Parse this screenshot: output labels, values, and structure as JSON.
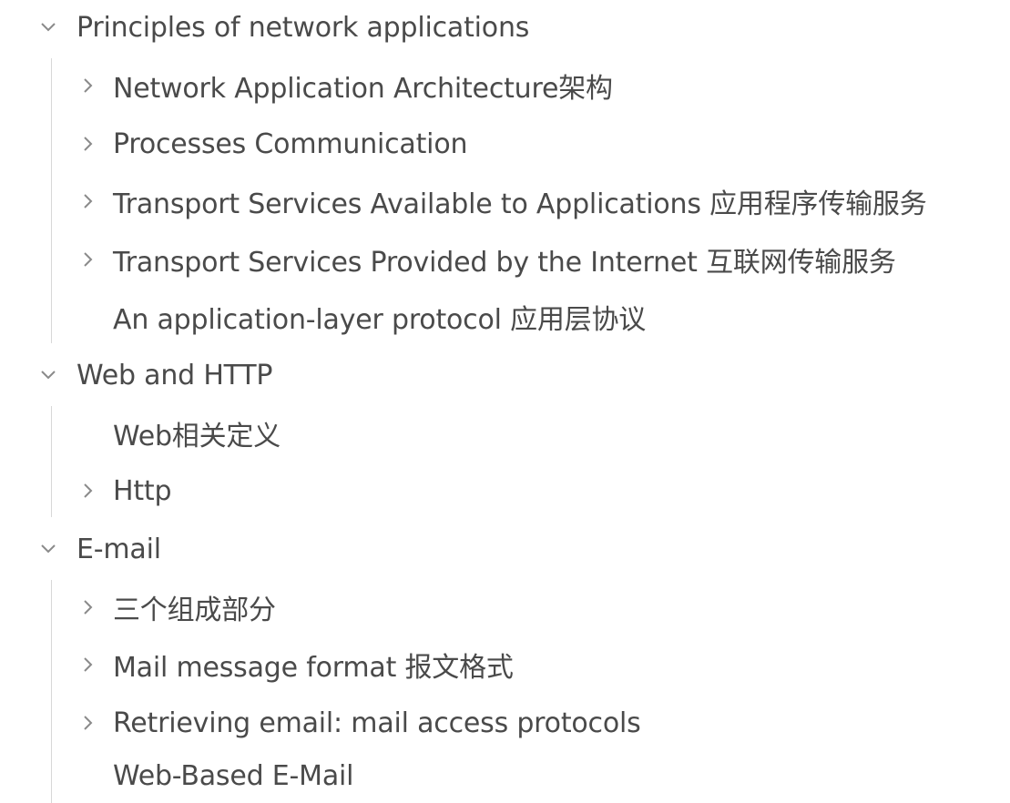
{
  "outline": {
    "sections": [
      {
        "label": "Principles of network applications",
        "expanded": true,
        "icon": "chevron-down-icon",
        "children": [
          {
            "label": "Network Application Architecture架构",
            "has_children": true,
            "icon": "chevron-right-icon"
          },
          {
            "label": "Processes Communication",
            "has_children": true,
            "icon": "chevron-right-icon"
          },
          {
            "label": "Transport Services Available to Applications 应用程序传输服务",
            "has_children": true,
            "icon": "chevron-right-icon"
          },
          {
            "label": "Transport Services Provided by the Internet 互联网传输服务",
            "has_children": true,
            "icon": "chevron-right-icon"
          },
          {
            "label": "An application-layer protocol 应用层协议",
            "has_children": false
          }
        ]
      },
      {
        "label": "Web and HTTP",
        "expanded": true,
        "icon": "chevron-down-icon",
        "children": [
          {
            "label": "Web相关定义",
            "has_children": false
          },
          {
            "label": "Http",
            "has_children": true,
            "icon": "chevron-right-icon"
          }
        ]
      },
      {
        "label": "E-mail",
        "expanded": true,
        "icon": "chevron-down-icon",
        "children": [
          {
            "label": "三个组成部分",
            "has_children": true,
            "icon": "chevron-right-icon"
          },
          {
            "label": "Mail message format 报文格式",
            "has_children": true,
            "icon": "chevron-right-icon"
          },
          {
            "label": "Retrieving email: mail access protocols",
            "has_children": true,
            "icon": "chevron-right-icon"
          },
          {
            "label": "Web-Based E-Mail",
            "has_children": false
          }
        ]
      }
    ]
  },
  "colors": {
    "text": "#4a4a4a",
    "chevron": "#8a8a8a",
    "guide_line": "#d8d8d8",
    "background": "#ffffff"
  }
}
